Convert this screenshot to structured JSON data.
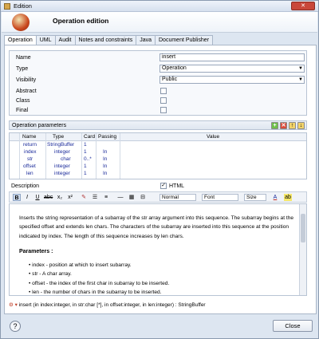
{
  "window": {
    "title": "Edition",
    "close_label": "✕"
  },
  "header": {
    "title": "Operation edition"
  },
  "tabs": [
    {
      "label": "Operation",
      "active": true
    },
    {
      "label": "UML"
    },
    {
      "label": "Audit"
    },
    {
      "label": "Notes and constraints"
    },
    {
      "label": "Java"
    },
    {
      "label": "Document Publisher"
    }
  ],
  "properties": {
    "name_label": "Name",
    "name_value": "insert",
    "type_label": "Type",
    "type_value": "Operation",
    "visibility_label": "Visibility",
    "visibility_value": "Public",
    "abstract_label": "Abstract",
    "class_label": "Class",
    "final_label": "Final"
  },
  "parameters": {
    "section_label": "Operation parameters",
    "columns": [
      "Name",
      "Type",
      "Card",
      "Passing",
      "Value"
    ],
    "rows": [
      {
        "name": "return",
        "type": "StringBuffer",
        "card": "1",
        "passing": ""
      },
      {
        "name": "index",
        "type": "integer",
        "card": "1",
        "passing": "In"
      },
      {
        "name": "str",
        "type": "char",
        "card": "0..*",
        "passing": "In"
      },
      {
        "name": "offset",
        "type": "integer",
        "card": "1",
        "passing": "In"
      },
      {
        "name": "len",
        "type": "integer",
        "card": "1",
        "passing": "In"
      }
    ]
  },
  "description": {
    "label": "Description",
    "html_label": "HTML",
    "style_select": "Normal",
    "font_select": "Font",
    "size_select": "Size",
    "text": "Inserts the string representation of a subarray of the str array argument into this sequence. The subarray begins at the specified offset and extends len chars. The characters of the subarray are inserted into this sequence at the position indicated by index. The length of this sequence increases by len chars.",
    "params_heading": "Parameters :",
    "params": [
      "index - position at which to insert subarray.",
      "str - A char array.",
      "offset - the index of the first char in subarray to be inserted.",
      "len - the number of chars in the subarray to be inserted."
    ]
  },
  "signature": "insert (in index:integer, in str:char [*], in offset:integer, in len:integer) : StringBuffer",
  "footer": {
    "help_label": "?",
    "close_label": "Close"
  }
}
